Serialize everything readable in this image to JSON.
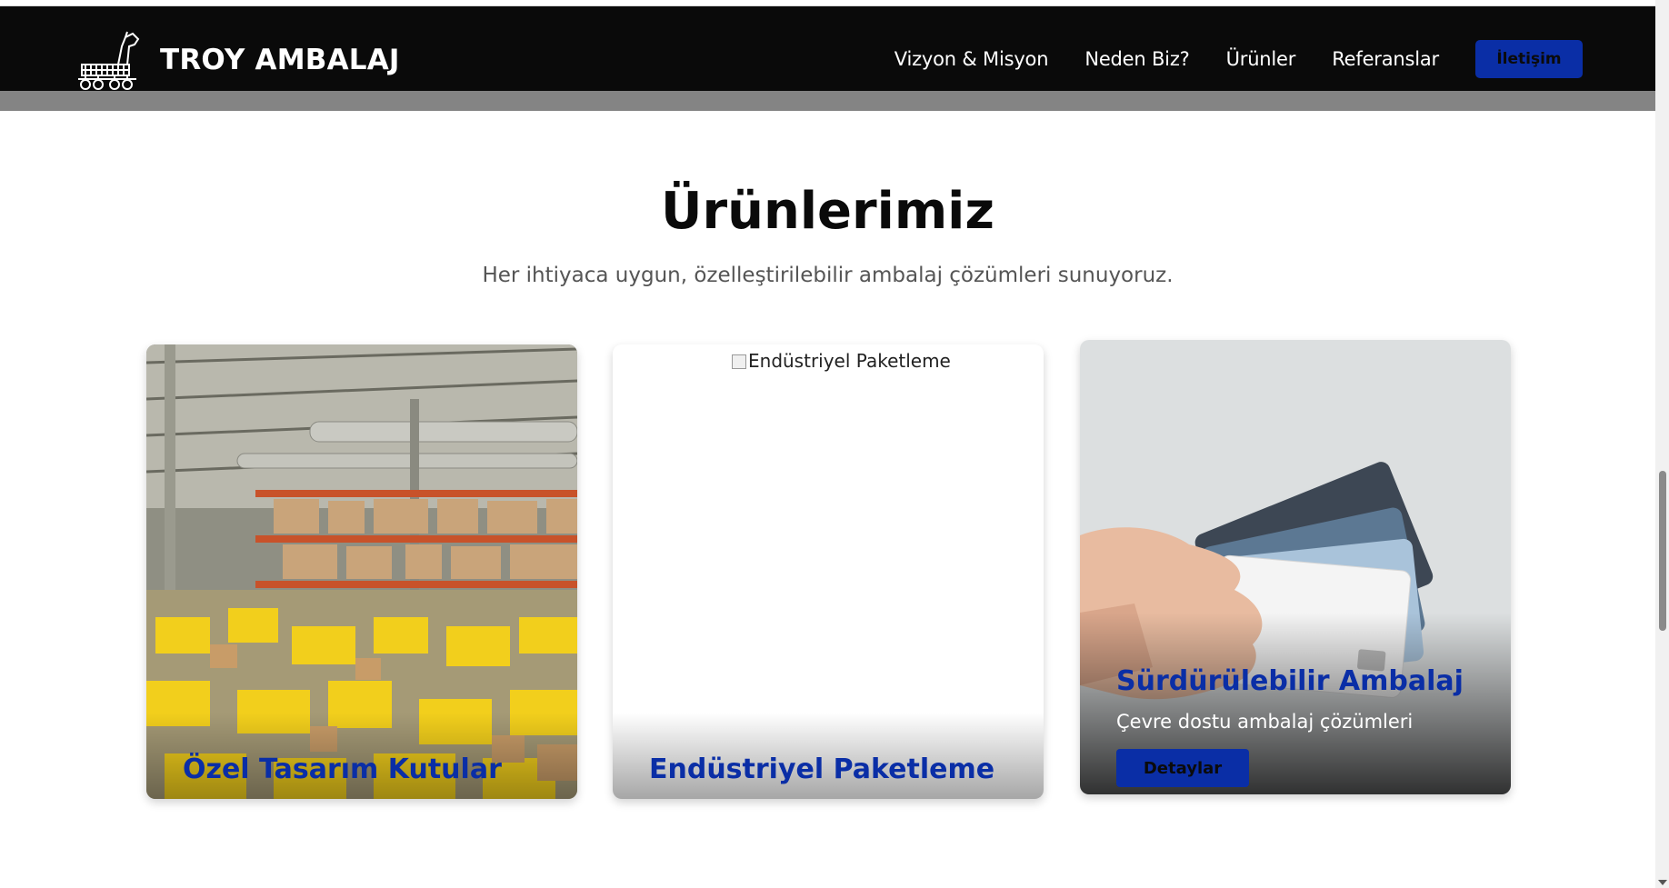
{
  "brand": {
    "name": "TROY AMBALAJ",
    "logo_icon": "trojan-horse-icon"
  },
  "nav": {
    "links": [
      "Vizyon & Misyon",
      "Neden Biz?",
      "Ürünler",
      "Referanslar"
    ],
    "cta_label": "İletişim"
  },
  "section": {
    "title": "Ürünlerimiz",
    "subtitle": "Her ihtiyaca uygun, özelleştirilebilir ambalaj çözümleri sunuyoruz."
  },
  "cards": [
    {
      "title": "Özel Tasarım Kutular",
      "image": "warehouse-photo"
    },
    {
      "title": "Endüstriyel Paketleme",
      "image_alt": "Endüstriyel Paketleme"
    },
    {
      "title": "Sürdürülebilir Ambalaj",
      "description": "Çevre dostu ambalaj çözümleri",
      "button_label": "Detaylar",
      "image": "credit-cards-photo"
    }
  ],
  "colors": {
    "accent": "#0a2ea6",
    "navbar": "#0a0a0a",
    "band": "#848484"
  }
}
